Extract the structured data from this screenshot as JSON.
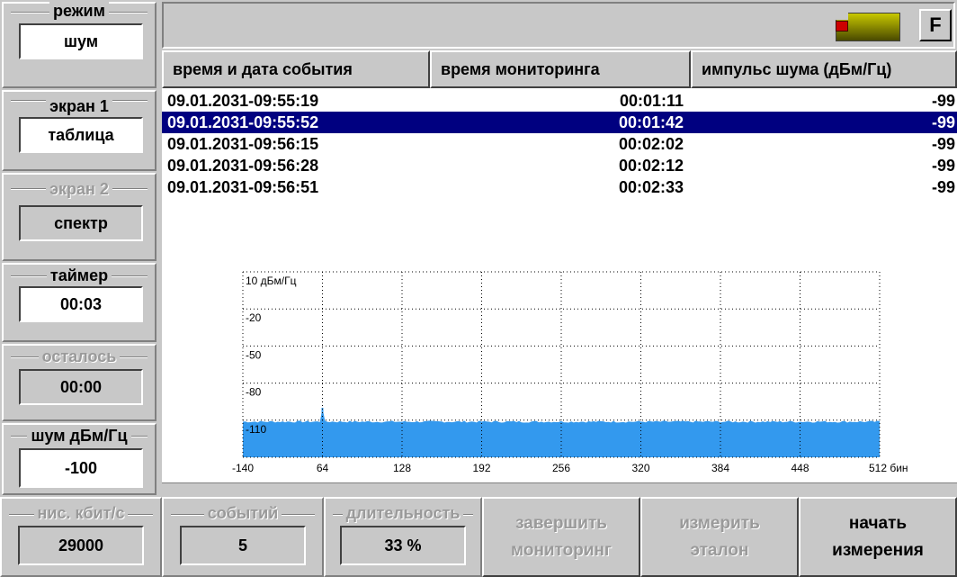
{
  "left_panel": {
    "mode": {
      "title": "режим",
      "value": "шум"
    },
    "screen1": {
      "title": "экран 1",
      "value": "таблица"
    },
    "screen2": {
      "title": "экран 2",
      "value": "спектр"
    },
    "timer": {
      "title": "таймер",
      "value": "00:03"
    },
    "remaining": {
      "title": "осталось",
      "value": "00:00"
    },
    "noise": {
      "title": "шум дБм/Гц",
      "value": "-100"
    }
  },
  "top_bar": {
    "f_button": "F"
  },
  "table": {
    "headers": [
      "время и дата события",
      "время мониторинга",
      "импульс шума (дБм/Гц)"
    ],
    "rows": [
      [
        "09.01.2031-09:55:19",
        "00:01:11",
        "-99"
      ],
      [
        "09.01.2031-09:55:52",
        "00:01:42",
        "-99"
      ],
      [
        "09.01.2031-09:56:15",
        "00:02:02",
        "-99"
      ],
      [
        "09.01.2031-09:56:28",
        "00:02:12",
        "-99"
      ],
      [
        "09.01.2031-09:56:51",
        "00:02:33",
        "-99"
      ]
    ],
    "selected_row": 1
  },
  "chart_data": {
    "type": "area",
    "y_ticks": [
      "10 дБм/Гц",
      "-20",
      "-50",
      "-80",
      "-110"
    ],
    "x_ticks": [
      "-140",
      "64",
      "128",
      "192",
      "256",
      "320",
      "384",
      "448",
      "512 бин"
    ],
    "x_range": [
      0,
      512
    ],
    "y_range": [
      -140,
      10
    ],
    "noise_floor": -112,
    "spike": {
      "x": 64,
      "y": -100
    },
    "grid": true,
    "fill_color": "#3399ee"
  },
  "bottom": {
    "rate": {
      "title": "нис. кбит/с",
      "value": "29000"
    },
    "events": {
      "title": "событий",
      "value": "5"
    },
    "duration": {
      "title": "длительность",
      "value": "33 %"
    },
    "btn_finish": [
      "завершить",
      "мониторинг"
    ],
    "btn_measure": [
      "измерить",
      "эталон"
    ],
    "btn_start": [
      "начать",
      "измерения"
    ]
  }
}
